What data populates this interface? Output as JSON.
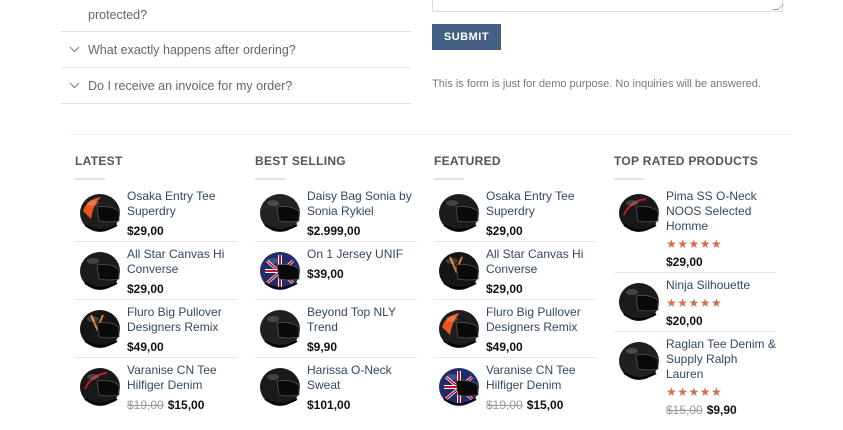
{
  "faq": {
    "partial_question": "protected?",
    "items": [
      {
        "question": "What exactly happens after ordering?"
      },
      {
        "question": "Do I receive an invoice for my order?"
      }
    ]
  },
  "form": {
    "submit_label": "SUBMIT",
    "note": "This is form is just for demo purpose. No inquiries will be answered."
  },
  "colors": {
    "accent": "#446084",
    "star": "#d26e4b",
    "link": "#334862"
  },
  "columns": [
    {
      "title": "LATEST",
      "products": [
        {
          "name": "Osaka Entry Tee Superdry",
          "price": "$29,00",
          "icon": "helmet-orange-icon"
        },
        {
          "name": "All Star Canvas Hi Converse",
          "price": "$29,00",
          "icon": "helmet-black-icon"
        },
        {
          "name": "Fluro Big Pullover Designers Remix",
          "price": "$49,00",
          "icon": "helmet-black-orange-icon"
        },
        {
          "name": "Varanise CN Tee Hilfiger Denim",
          "old_price": "$19,00",
          "price": "$15,00",
          "icon": "helmet-black-red-icon"
        }
      ]
    },
    {
      "title": "BEST SELLING",
      "products": [
        {
          "name": "Daisy Bag Sonia by Sonia Rykiel",
          "price": "$2.999,00",
          "icon": "helmet-adventure-icon"
        },
        {
          "name": "On 1 Jersey UNIF",
          "price": "$39,00",
          "icon": "helmet-union-jack-icon"
        },
        {
          "name": "Beyond Top NLY Trend",
          "price": "$9,90",
          "icon": "helmet-matte-black-icon"
        },
        {
          "name": "Harissa O-Neck Sweat",
          "price": "$101,00",
          "icon": "helmet-modular-icon"
        }
      ]
    },
    {
      "title": "FEATURED",
      "products": [
        {
          "name": "Osaka Entry Tee Superdry",
          "price": "$29,00",
          "icon": "helmet-black-icon"
        },
        {
          "name": "All Star Canvas Hi Converse",
          "price": "$29,00",
          "icon": "helmet-black-orange-icon"
        },
        {
          "name": "Fluro Big Pullover Designers Remix",
          "price": "$49,00",
          "icon": "helmet-orange-icon"
        },
        {
          "name": "Varanise CN Tee Hilfiger Denim",
          "old_price": "$19,00",
          "price": "$15,00",
          "icon": "helmet-union-jack-icon"
        }
      ]
    },
    {
      "title": "TOP RATED PRODUCTS",
      "products": [
        {
          "name": "Pima SS O-Neck NOOS Selected Homme",
          "rating": 5,
          "price": "$29,00",
          "icon": "helmet-black-red-icon"
        },
        {
          "name": "Ninja Silhouette",
          "rating": 5,
          "price": "$20,00",
          "icon": "helmet-black-icon"
        },
        {
          "name": "Raglan Tee Denim & Supply Ralph Lauren",
          "rating": 5,
          "old_price": "$15,00",
          "price": "$9,90",
          "icon": "helmet-matte-black-icon"
        }
      ]
    }
  ]
}
